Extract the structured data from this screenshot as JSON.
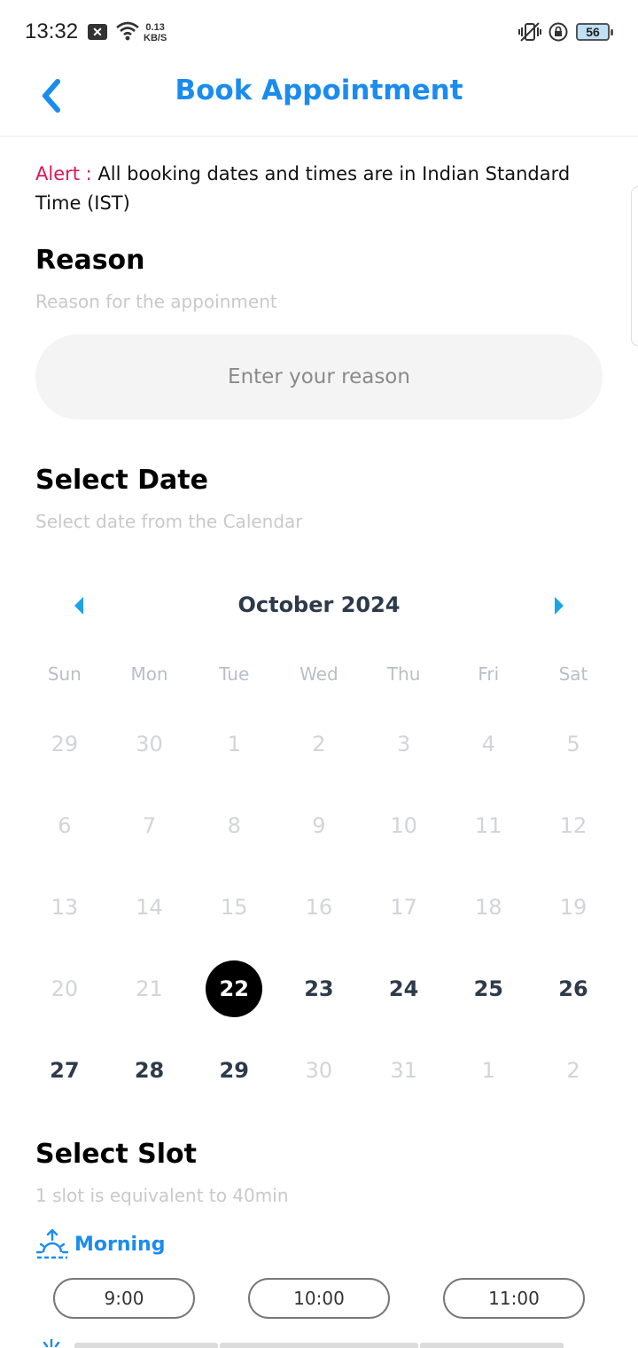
{
  "status_bar": {
    "time": "13:32",
    "notification_icon": "x-box-icon",
    "speed_value": "0.13",
    "speed_unit": "KB/S",
    "battery": "56"
  },
  "header": {
    "title": "Book Appointment",
    "back_icon": "chevron-left-icon"
  },
  "alert": {
    "label": "Alert :",
    "text": " All booking dates and times are in Indian Standard Time (IST)"
  },
  "reason": {
    "title": "Reason",
    "subtitle": "Reason for the appoinment",
    "placeholder": "Enter your reason"
  },
  "date": {
    "title": "Select Date",
    "subtitle": "Select date from the Calendar"
  },
  "calendar": {
    "month_label": "October 2024",
    "weekdays": [
      "Sun",
      "Mon",
      "Tue",
      "Wed",
      "Thu",
      "Fri",
      "Sat"
    ],
    "selected_day": "22",
    "days": [
      {
        "d": "29",
        "state": "disabled"
      },
      {
        "d": "30",
        "state": "disabled"
      },
      {
        "d": "1",
        "state": "disabled"
      },
      {
        "d": "2",
        "state": "disabled"
      },
      {
        "d": "3",
        "state": "disabled"
      },
      {
        "d": "4",
        "state": "disabled"
      },
      {
        "d": "5",
        "state": "disabled"
      },
      {
        "d": "6",
        "state": "disabled"
      },
      {
        "d": "7",
        "state": "disabled"
      },
      {
        "d": "8",
        "state": "disabled"
      },
      {
        "d": "9",
        "state": "disabled"
      },
      {
        "d": "10",
        "state": "disabled"
      },
      {
        "d": "11",
        "state": "disabled"
      },
      {
        "d": "12",
        "state": "disabled"
      },
      {
        "d": "13",
        "state": "disabled"
      },
      {
        "d": "14",
        "state": "disabled"
      },
      {
        "d": "15",
        "state": "disabled"
      },
      {
        "d": "16",
        "state": "disabled"
      },
      {
        "d": "17",
        "state": "disabled"
      },
      {
        "d": "18",
        "state": "disabled"
      },
      {
        "d": "19",
        "state": "disabled"
      },
      {
        "d": "20",
        "state": "disabled"
      },
      {
        "d": "21",
        "state": "disabled"
      },
      {
        "d": "22",
        "state": "selected"
      },
      {
        "d": "23",
        "state": "enabled"
      },
      {
        "d": "24",
        "state": "enabled"
      },
      {
        "d": "25",
        "state": "enabled"
      },
      {
        "d": "26",
        "state": "enabled"
      },
      {
        "d": "27",
        "state": "enabled"
      },
      {
        "d": "28",
        "state": "enabled"
      },
      {
        "d": "29",
        "state": "enabled"
      },
      {
        "d": "30",
        "state": "disabled"
      },
      {
        "d": "31",
        "state": "disabled"
      },
      {
        "d": "1",
        "state": "disabled"
      },
      {
        "d": "2",
        "state": "disabled"
      }
    ]
  },
  "slot": {
    "title": "Select Slot",
    "subtitle": "1 slot is equivalent to 40min",
    "morning_label": "Morning",
    "morning_icon": "sunrise-icon",
    "morning_slots": [
      "9:00",
      "10:00",
      "11:00"
    ],
    "afternoon_icon": "sun-icon"
  },
  "colors": {
    "accent": "#1a8cf0",
    "alert": "#e0145a",
    "selected_day": "#000000"
  }
}
